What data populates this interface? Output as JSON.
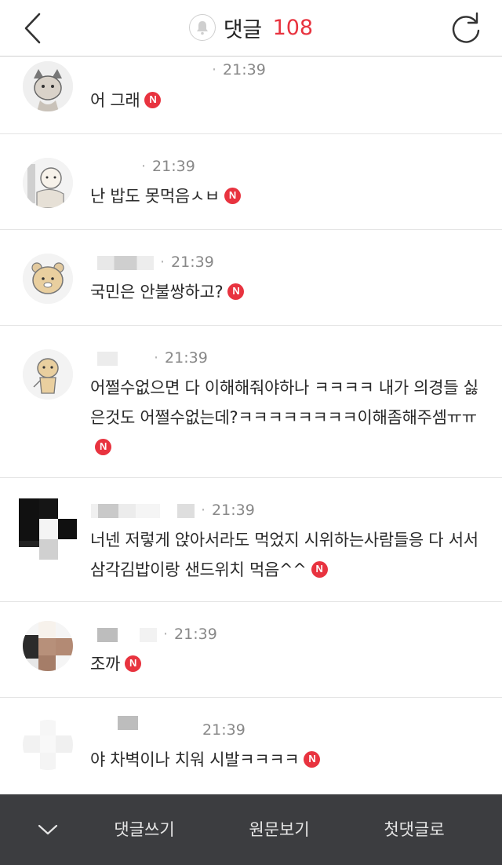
{
  "header": {
    "title": "댓글",
    "count": "108",
    "back_icon": "chevron-left-icon",
    "bell_icon": "bell-icon",
    "refresh_icon": "refresh-icon",
    "accent_color": "#e8333f"
  },
  "comments": [
    {
      "time": "21:39",
      "text": "어 그래",
      "new_badge": "N"
    },
    {
      "time": "21:39",
      "text": "난 밥도 못먹음ㅅㅂ",
      "new_badge": "N"
    },
    {
      "time": "21:39",
      "text": "국민은 안불쌍하고?",
      "new_badge": "N"
    },
    {
      "time": "21:39",
      "text": "어쩔수없으면 다 이해해줘야하나 ㅋㅋㅋㅋ 내가 의경들 싫은것도 어쩔수없는데?ㅋㅋㅋㅋㅋㅋㅋㅋ이해좀해주셈ㅠㅠ",
      "new_badge": "N"
    },
    {
      "time": "21:39",
      "text": "너넨 저렇게 앉아서라도 먹었지 시위하는사람들응 다 서서 삼각김밥이랑 샌드위치 먹음^^",
      "new_badge": "N"
    },
    {
      "time": "21:39",
      "text": "조까",
      "new_badge": "N"
    },
    {
      "time": "21:39",
      "text": "야 차벽이나 치워 시발ㅋㅋㅋㅋ",
      "new_badge": "N"
    }
  ],
  "bottom_bar": {
    "collapse_icon": "chevron-down-icon",
    "write_label": "댓글쓰기",
    "original_label": "원문보기",
    "first_label": "첫댓글로"
  }
}
